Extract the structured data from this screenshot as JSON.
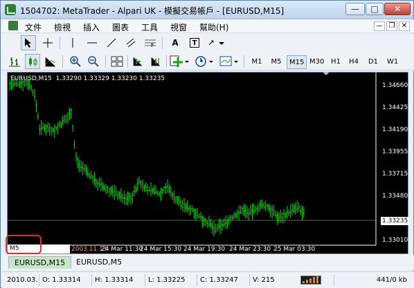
{
  "window": {
    "title": "1504702: MetaTrader - Alpari UK - 模擬交易帳戶 - [EURUSD,M15]",
    "minimize": "—",
    "maximize": "□",
    "close": "✕"
  },
  "menu": {
    "items": [
      "文件",
      "檢視",
      "插入",
      "圖表",
      "工具",
      "視窗",
      "幫助(H)"
    ],
    "mdi_minimize": "—",
    "mdi_restore": "❐",
    "mdi_close": "✕"
  },
  "toolbar": {
    "row2_label_a": "A",
    "row2_label_t": "T",
    "timeframes": [
      "M1",
      "M5",
      "M15",
      "M30",
      "H1",
      "H4",
      "D1",
      "W1"
    ],
    "active_timeframe": "M15"
  },
  "chart": {
    "symbol_label": "EURUSD,M15",
    "ohlc": "1.33290 1.33329 1.33230 1.33235",
    "price_scale": [
      "1.34660",
      "1.34425",
      "1.34190",
      "1.33955",
      "1.33715",
      "1.33480",
      "1.33235",
      "1.33010"
    ],
    "current_price": "1.33235",
    "time_scale": [
      "2003.11.13",
      "24 Mar 11:30",
      "24 Mar 15:30",
      "24 Mar 19:30",
      "24 Mar 23:30",
      "25 Mar 03:30"
    ],
    "timeframe_overlay": "M5",
    "bar_color": "#00e000",
    "background_color": "#000000"
  },
  "tabs": {
    "items": [
      "EURUSD,M15",
      "EURUSD,M5"
    ],
    "active": "EURUSD,M15"
  },
  "status": {
    "date": "2010.03.",
    "open": "O: 1.33314",
    "high": "H: 1.33314",
    "low": "L: 1.33225",
    "close": "C: 1.33247",
    "volume": "V: 215",
    "traffic": "441/0 kb"
  }
}
